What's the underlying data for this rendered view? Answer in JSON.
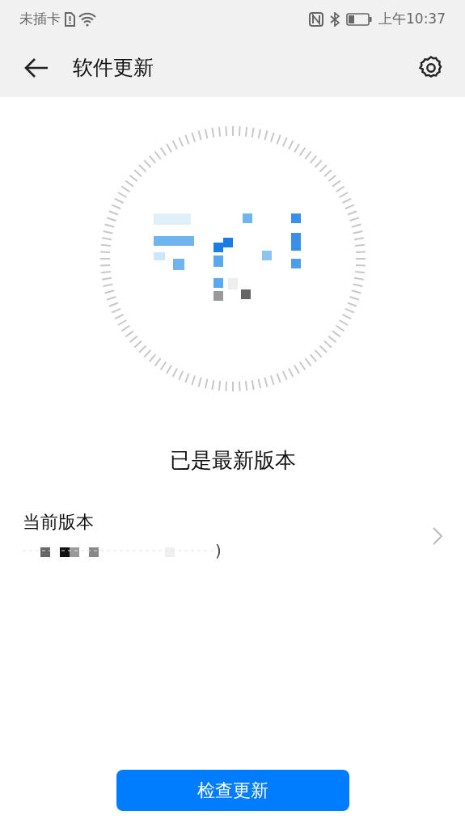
{
  "status_bar": {
    "carrier": "未插卡",
    "time": "上午10:37"
  },
  "header": {
    "title": "软件更新"
  },
  "status_message": "已是最新版本",
  "version_row": {
    "label": "当前版本",
    "value_visible_end": ")"
  },
  "check_button": {
    "label": "检查更新"
  }
}
